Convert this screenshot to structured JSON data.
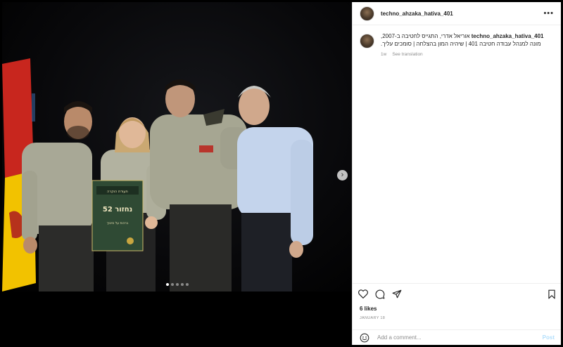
{
  "post": {
    "username": "techno_ahzaka_hativa_401",
    "caption_user": "techno_ahzaka_hativa_401",
    "caption_text": "אוריאל אדרי, התגייס לחטיבה ב-2007, מונה למנהל עבודה חטיבה 401 | שיהיה המון בהצלחה | סומכים עליך.",
    "time_ago": "1w",
    "see_translation": "See translation",
    "likes": "6 likes",
    "date": "JANUARY 18"
  },
  "certificate": {
    "top_text": "תעודת הוקרה",
    "big_text": "נחזור 52",
    "small_text": "ברכות על מינויך"
  },
  "comment": {
    "placeholder": "Add a comment...",
    "post_label": "Post"
  },
  "carousel": {
    "next_symbol": "›",
    "slides": 5,
    "active_slide": 1
  },
  "icons": {
    "more": "more-options-icon",
    "like": "heart-icon",
    "comment": "comment-icon",
    "share": "share-icon",
    "save": "bookmark-icon",
    "emoji": "emoji-icon"
  },
  "colors": {
    "link_disabled": "#b2dffc",
    "secondary_text": "#8e8e8e",
    "border": "#dbdbdb"
  }
}
